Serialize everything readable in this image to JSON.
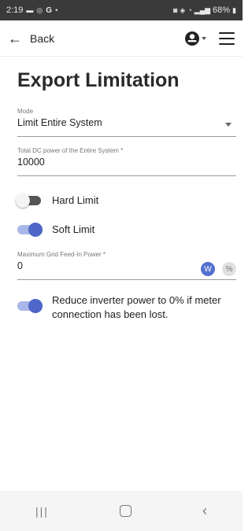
{
  "status_bar": {
    "time": "2:19",
    "battery": "68%"
  },
  "app_bar": {
    "back_label": "Back"
  },
  "page": {
    "title": "Export Limitation"
  },
  "mode": {
    "label": "Mode",
    "value": "Limit Entire System"
  },
  "dc_power": {
    "label": "Total DC power of the Entire System *",
    "value": "10000"
  },
  "hard_limit": {
    "label": "Hard Limit",
    "enabled": false
  },
  "soft_limit": {
    "label": "Soft Limit",
    "enabled": true
  },
  "grid_feed": {
    "label": "Maximum Grid Feed-In Power *",
    "value": "0",
    "units": [
      "W",
      "%"
    ],
    "selected_unit": "W"
  },
  "reduce_power": {
    "label": "Reduce inverter power to 0% if meter connection has been lost.",
    "enabled": true
  },
  "colors": {
    "accent": "#4d66c8",
    "status_bar": "#3a3a3a"
  }
}
